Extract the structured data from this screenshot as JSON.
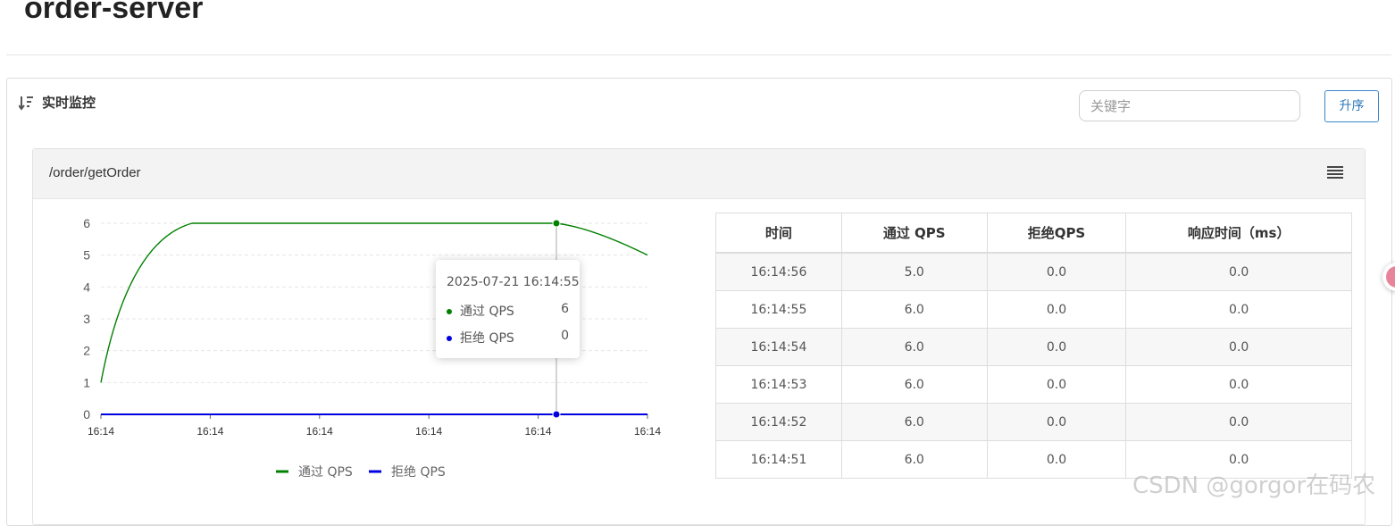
{
  "page": {
    "title": "order-server"
  },
  "panel": {
    "heading": "实时监控",
    "search_placeholder": "关键字",
    "sort_button": "升序"
  },
  "resource": {
    "name": "/order/getOrder"
  },
  "chart_data": {
    "type": "line",
    "x": [
      "16:14",
      "16:14",
      "16:14",
      "16:14",
      "16:14",
      "16:14"
    ],
    "ylim": [
      0,
      6
    ],
    "yticks": [
      "0",
      "1",
      "2",
      "3",
      "4",
      "5",
      "6"
    ],
    "series": [
      {
        "name": "通过 QPS",
        "color": "#008000",
        "values": [
          1,
          6,
          6,
          6,
          6,
          6,
          5
        ]
      },
      {
        "name": "拒绝 QPS",
        "color": "#0000e0",
        "values": [
          0,
          0,
          0,
          0,
          0,
          0,
          0
        ]
      }
    ],
    "legend_position": "bottom",
    "grid": true,
    "tooltip": {
      "time": "2025-07-21 16:14:55",
      "rows": [
        {
          "name": "通过 QPS",
          "value": "6",
          "color": "#008000"
        },
        {
          "name": "拒绝 QPS",
          "value": "0",
          "color": "#0000e0"
        }
      ]
    }
  },
  "table": {
    "headers": [
      "时间",
      "通过 QPS",
      "拒绝QPS",
      "响应时间（ms）"
    ],
    "rows": [
      [
        "16:14:56",
        "5.0",
        "0.0",
        "0.0"
      ],
      [
        "16:14:55",
        "6.0",
        "0.0",
        "0.0"
      ],
      [
        "16:14:54",
        "6.0",
        "0.0",
        "0.0"
      ],
      [
        "16:14:53",
        "6.0",
        "0.0",
        "0.0"
      ],
      [
        "16:14:52",
        "6.0",
        "0.0",
        "0.0"
      ],
      [
        "16:14:51",
        "6.0",
        "0.0",
        "0.0"
      ]
    ]
  },
  "watermark": "CSDN @gorgor在码农"
}
